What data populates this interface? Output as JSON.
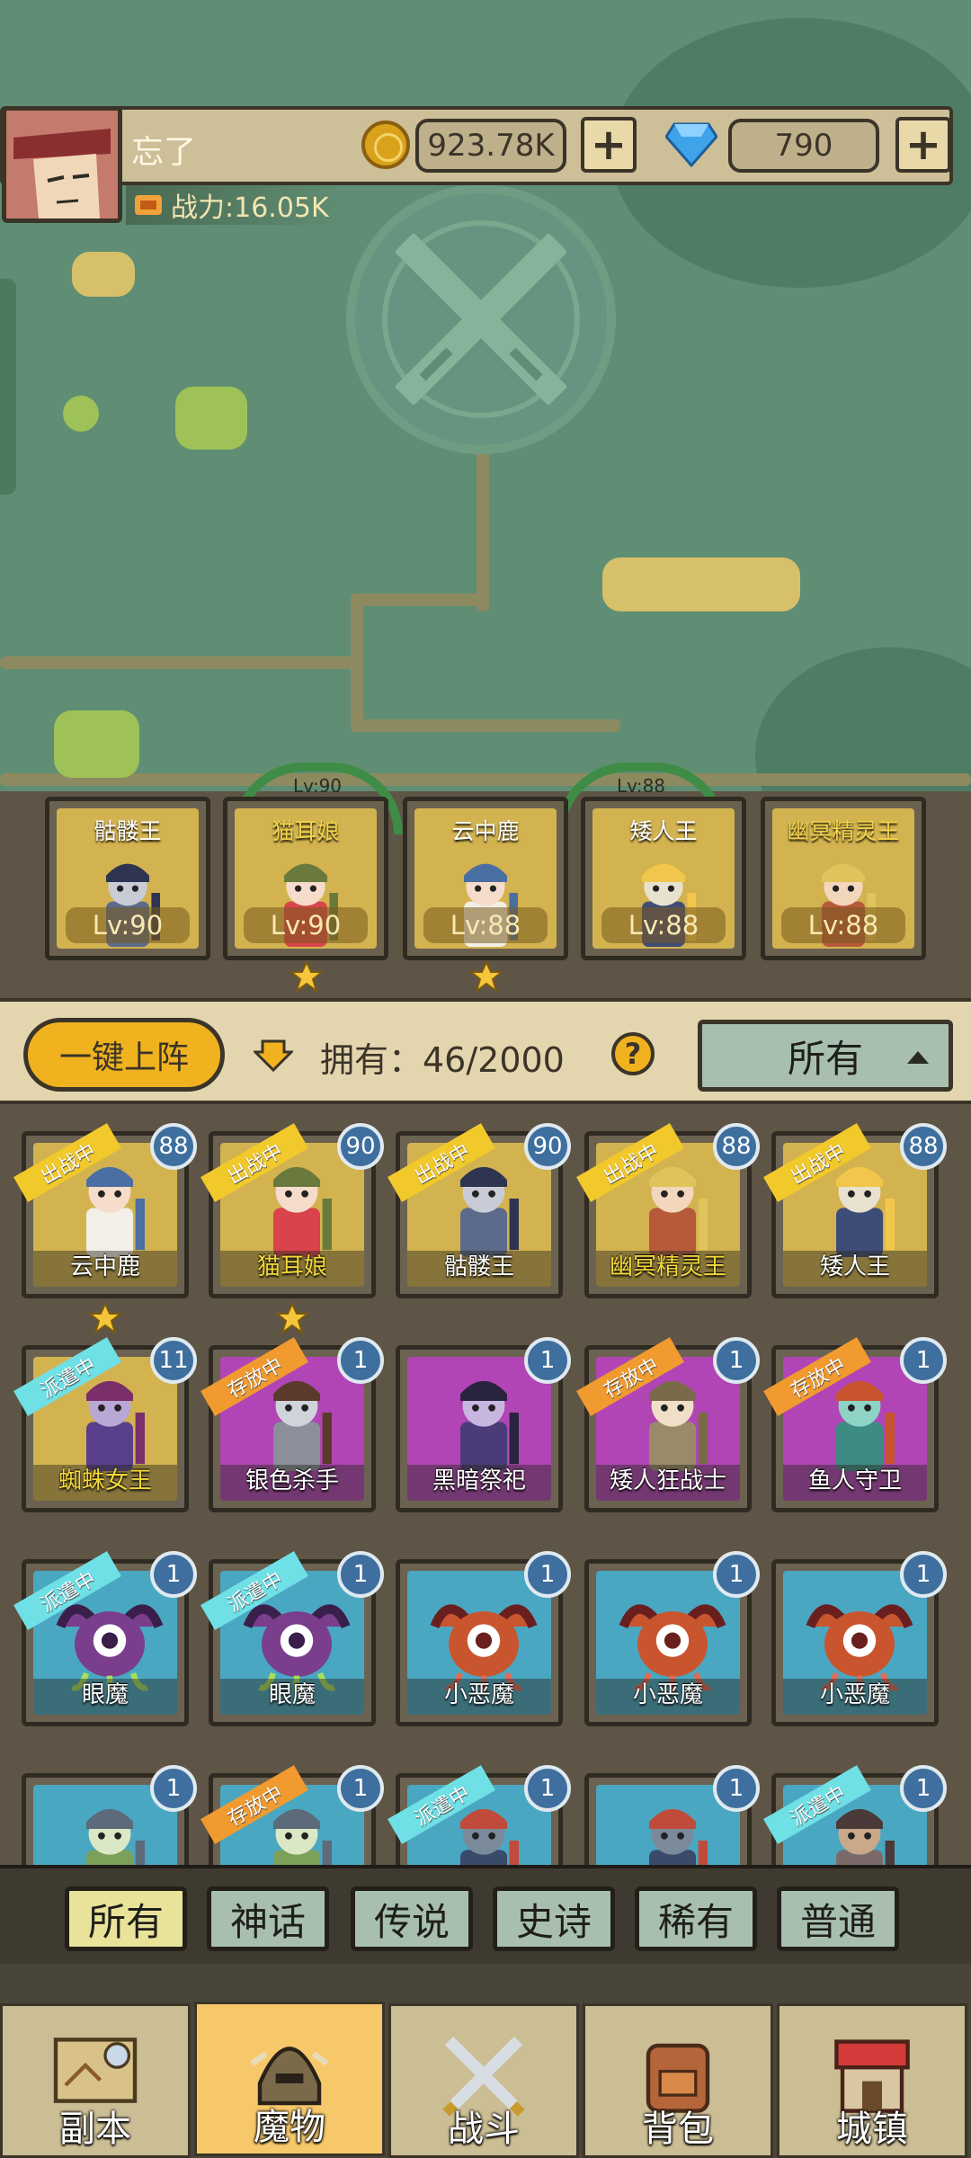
{
  "player": {
    "name": "忘了",
    "gold": "923.78K",
    "gems": "790",
    "power": "战力:16.05K"
  },
  "team": [
    {
      "name": "骷髅王",
      "level": "Lv:90",
      "name_color": "white",
      "char": "skeleton-king",
      "star": false
    },
    {
      "name": "猫耳娘",
      "level": "Lv:90",
      "name_color": "gold",
      "char": "cat-girl",
      "star": true
    },
    {
      "name": "云中鹿",
      "level": "Lv:88",
      "name_color": "white",
      "char": "cloud-deer",
      "star": true
    },
    {
      "name": "矮人王",
      "level": "Lv:88",
      "name_color": "white",
      "char": "dwarf-king",
      "star": false
    },
    {
      "name": "幽冥精灵王",
      "level": "Lv:88",
      "name_color": "gold",
      "char": "nether-elf-king",
      "star": false
    }
  ],
  "team_arcs": [
    "Lv:90",
    "Lv:88"
  ],
  "controls": {
    "deploy_label": "一键上阵",
    "owned_text": "拥有：46/2000",
    "help_label": "?",
    "filter_label": "所有"
  },
  "status_labels": {
    "battle": "出战中",
    "dispatch": "派遣中",
    "stored": "存放中"
  },
  "monsters": [
    {
      "name": "云中鹿",
      "level": "88",
      "status": "出战中",
      "bg": "gold",
      "gold_name": false,
      "star": true,
      "char": "cloud-deer"
    },
    {
      "name": "猫耳娘",
      "level": "90",
      "status": "出战中",
      "bg": "gold",
      "gold_name": true,
      "star": true,
      "char": "cat-girl"
    },
    {
      "name": "骷髅王",
      "level": "90",
      "status": "出战中",
      "bg": "gold",
      "gold_name": false,
      "star": false,
      "char": "skeleton-king"
    },
    {
      "name": "幽冥精灵王",
      "level": "88",
      "status": "出战中",
      "bg": "gold",
      "gold_name": true,
      "star": false,
      "char": "nether-elf-king"
    },
    {
      "name": "矮人王",
      "level": "88",
      "status": "出战中",
      "bg": "gold",
      "gold_name": false,
      "star": false,
      "char": "dwarf-king"
    },
    {
      "name": "蜘蛛女王",
      "level": "11",
      "status": "派遣中",
      "bg": "gold",
      "gold_name": true,
      "star": false,
      "char": "spider-queen"
    },
    {
      "name": "银色杀手",
      "level": "1",
      "status": "存放中",
      "bg": "purple",
      "gold_name": false,
      "star": false,
      "char": "silver-assassin"
    },
    {
      "name": "黑暗祭祀",
      "level": "1",
      "status": "",
      "bg": "purple",
      "gold_name": false,
      "star": false,
      "char": "dark-priest"
    },
    {
      "name": "矮人狂战士",
      "level": "1",
      "status": "存放中",
      "bg": "purple",
      "gold_name": false,
      "star": false,
      "char": "dwarf-berserker"
    },
    {
      "name": "鱼人守卫",
      "level": "1",
      "status": "存放中",
      "bg": "purple",
      "gold_name": false,
      "star": false,
      "char": "murloc-guard"
    },
    {
      "name": "眼魔",
      "level": "1",
      "status": "派遣中",
      "bg": "blue",
      "gold_name": false,
      "star": false,
      "char": "beholder"
    },
    {
      "name": "眼魔",
      "level": "1",
      "status": "派遣中",
      "bg": "blue",
      "gold_name": false,
      "star": false,
      "char": "beholder"
    },
    {
      "name": "小恶魔",
      "level": "1",
      "status": "",
      "bg": "blue",
      "gold_name": false,
      "star": false,
      "char": "imp"
    },
    {
      "name": "小恶魔",
      "level": "1",
      "status": "",
      "bg": "blue",
      "gold_name": false,
      "star": false,
      "char": "imp"
    },
    {
      "name": "小恶魔",
      "level": "1",
      "status": "",
      "bg": "blue",
      "gold_name": false,
      "star": false,
      "char": "imp"
    },
    {
      "name": "",
      "level": "1",
      "status": "",
      "bg": "blue",
      "gold_name": false,
      "star": false,
      "char": "goblin"
    },
    {
      "name": "",
      "level": "1",
      "status": "存放中",
      "bg": "blue",
      "gold_name": false,
      "star": false,
      "char": "goblin"
    },
    {
      "name": "",
      "level": "1",
      "status": "派遣中",
      "bg": "blue",
      "gold_name": false,
      "star": false,
      "char": "orc"
    },
    {
      "name": "",
      "level": "1",
      "status": "",
      "bg": "blue",
      "gold_name": false,
      "star": false,
      "char": "orc"
    },
    {
      "name": "",
      "level": "1",
      "status": "派遣中",
      "bg": "blue",
      "gold_name": false,
      "star": false,
      "char": "ogre"
    }
  ],
  "rarity_filters": [
    "所有",
    "神话",
    "传说",
    "史诗",
    "稀有",
    "普通"
  ],
  "active_rarity": "所有",
  "nav": [
    {
      "label": "副本",
      "icon": "map-icon"
    },
    {
      "label": "魔物",
      "icon": "monster-helmet-icon"
    },
    {
      "label": "战斗",
      "icon": "crossed-swords-icon"
    },
    {
      "label": "背包",
      "icon": "backpack-icon"
    },
    {
      "label": "城镇",
      "icon": "shop-icon"
    }
  ],
  "active_nav": "魔物",
  "colors": {
    "map_bg": "#5f8e74",
    "gold_accent": "#f0b21f",
    "card_gold": "#d3b350",
    "card_purple": "#b145b5",
    "card_blue": "#4aa7c2",
    "level_badge": "#3e6f9e"
  }
}
